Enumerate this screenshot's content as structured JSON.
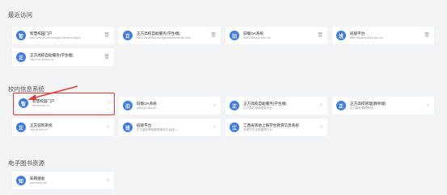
{
  "sections": [
    {
      "title": "最近访问",
      "cards": [
        {
          "name": "智慧校园门户",
          "url": "http://sso.jlf.edu.cn/login?service=http://...",
          "icon": "智",
          "color": "#3d7be0",
          "action": "trash-icon",
          "glyph": "🗑"
        },
        {
          "name": "正方高校自助服务(学生端)",
          "url": "http://cfs.jlf.edu.cn/xtgl/xsdwbcms/xtb.html",
          "icon": "正",
          "color": "#3d7be0",
          "action": "trash-icon",
          "glyph": "🗑"
        },
        {
          "name": "旧版OA系统",
          "url": "http://office.jlf.edu.cn/",
          "icon": "旧",
          "color": "#3d7be0",
          "action": "trash-icon",
          "glyph": "🗑"
        },
        {
          "name": "班级平台",
          "url": "http://bjcampus.jlf.edu.cn/",
          "icon": "班",
          "color": "#3d7be0",
          "action": "trash-icon",
          "glyph": "🗑"
        },
        {
          "name": "正方高校自助服务(学生端)",
          "url": "http://cfs.jlf.edu.cn/",
          "icon": "正",
          "color": "#3d7be0",
          "action": "trash-icon",
          "glyph": "🗑"
        }
      ]
    },
    {
      "title": "校内信息系统",
      "cards": [
        {
          "name": "智慧校园门户",
          "url": "sso.jlf.edu.cn",
          "icon": "智",
          "color": "#3d7be0",
          "action": "star-icon",
          "glyph": "☆"
        },
        {
          "name": "旧版OA系统",
          "url": "office.jlf.edu.cn",
          "icon": "旧",
          "color": "#3d7be0",
          "action": "star-icon",
          "glyph": "☆"
        },
        {
          "name": "正方高校自助服务(学生端)",
          "url": "正方高校自助服务平台",
          "icon": "正",
          "color": "#3d7be0",
          "action": "star-icon",
          "glyph": "☆"
        },
        {
          "name": "正方高校管理(教师端)",
          "url": "正方高校管理系统",
          "icon": "正",
          "color": "#3d7be0",
          "action": "star-icon",
          "glyph": "☆"
        },
        {
          "name": "正方迎新系统",
          "url": "zfyx.jlf.edu.cn",
          "icon": "正",
          "color": "#3d7be0",
          "action": "star-icon",
          "glyph": "☆"
        },
        {
          "name": "班级平台",
          "url": "正方高校基础数据服务平台接入",
          "icon": "班",
          "color": "#3d7be0",
          "action": "star-icon",
          "glyph": "☆"
        },
        {
          "name": "江西省资助上报学生教育信息系统",
          "url": "资助学生信息管理平台",
          "icon": "江",
          "color": "#3d7be0",
          "action": "star-icon",
          "glyph": "☆"
        }
      ]
    },
    {
      "title": "电子图书资源",
      "cards": [
        {
          "name": "知网搜索",
          "url": "www.cnki.net",
          "icon": "知",
          "color": "#3d7be0",
          "action": "star-icon",
          "glyph": "☆"
        }
      ]
    }
  ]
}
